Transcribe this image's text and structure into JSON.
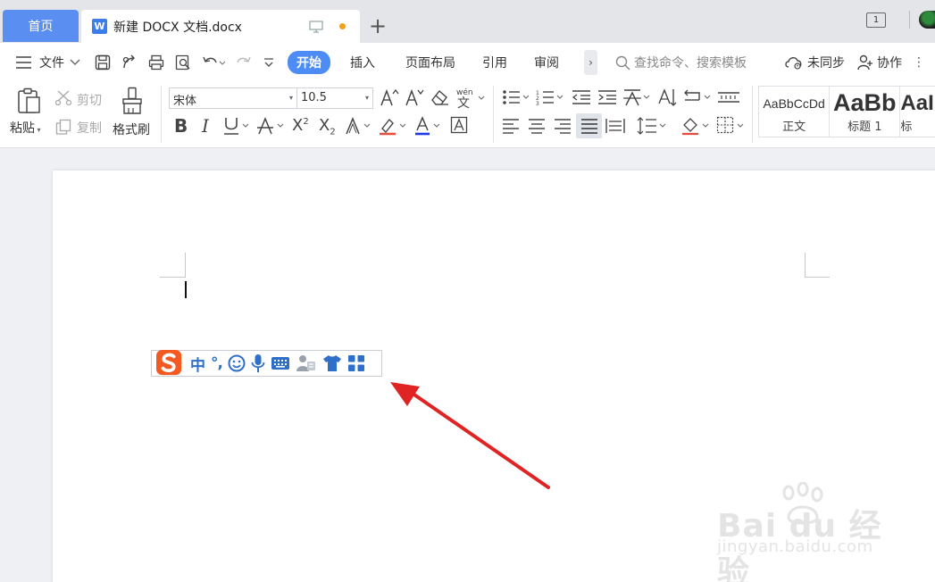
{
  "tabs": {
    "home": "首页",
    "doc_title": "新建 DOCX 文档.docx",
    "window_count": "1"
  },
  "menu": {
    "file": "文件",
    "tabs": [
      "开始",
      "插入",
      "页面布局",
      "引用",
      "审阅"
    ],
    "search_placeholder": "查找命令、搜索模板",
    "sync": "未同步",
    "collab": "协作"
  },
  "ribbon": {
    "paste": "粘贴",
    "cut": "剪切",
    "copy": "复制",
    "format_painter": "格式刷",
    "font_name": "宋体",
    "font_size": "10.5",
    "styles": [
      {
        "preview": "AaBbCcDd",
        "name": "正文"
      },
      {
        "preview": "AaBb",
        "name": "标题 1"
      },
      {
        "preview": "AaI",
        "name": "标"
      }
    ]
  },
  "ime": {
    "mode": "中",
    "punct": "°,"
  },
  "watermark": {
    "main": "Bai du 经验",
    "sub": "jingyan.baidu.com"
  },
  "colors": {
    "accent": "#4e8cf5",
    "home_tab": "#5a8ef0",
    "arrow": "#e02424",
    "ime_blue": "#2d6fc9",
    "sogou_orange": "#f25a22"
  }
}
